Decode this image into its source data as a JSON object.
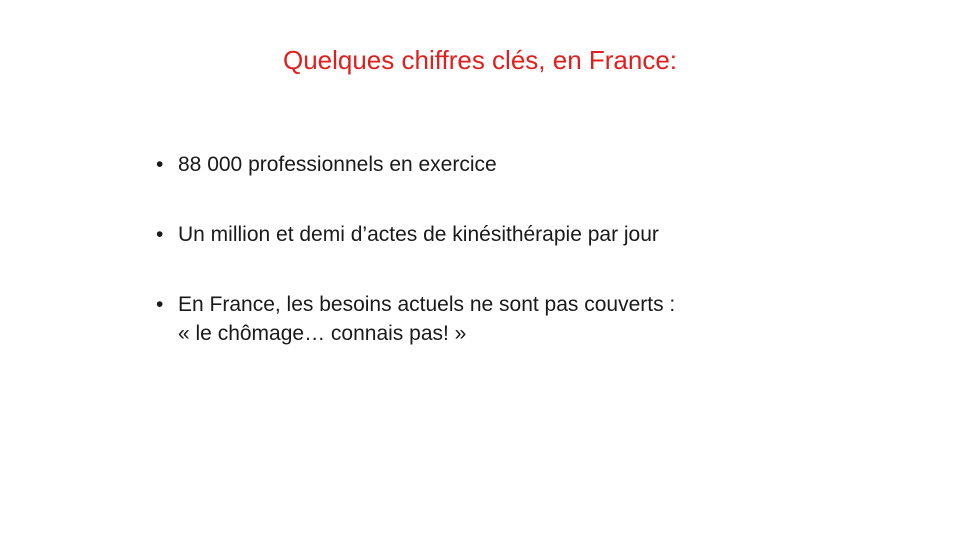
{
  "slide": {
    "title": "Quelques chiffres clés, en France:",
    "bullet_glyph": "•",
    "bullets": [
      {
        "lines": [
          "88 000 professionnels en exercice"
        ]
      },
      {
        "lines": [
          "Un million et demi d’actes de kinésithérapie par jour"
        ]
      },
      {
        "lines": [
          "En France, les besoins actuels ne sont pas couverts :",
          "« le chômage… connais pas! »"
        ]
      }
    ],
    "colors": {
      "title": "#e0201f",
      "body_text": "#1a1a1a",
      "background": "#ffffff"
    }
  }
}
